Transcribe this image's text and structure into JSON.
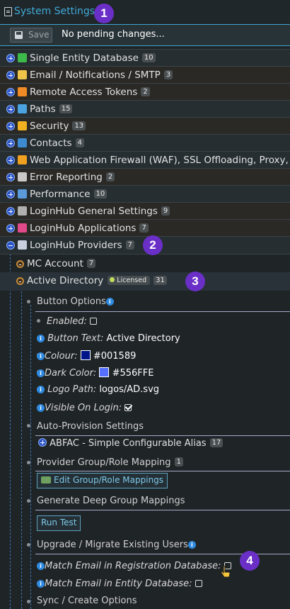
{
  "header": {
    "title": "System Settings"
  },
  "markers": [
    "1",
    "2",
    "3",
    "4"
  ],
  "toolbar": {
    "save_label": "Save",
    "status": "No pending changes..."
  },
  "tree": [
    {
      "label": "Single Entity Database",
      "count": "10",
      "icon": "database-icon",
      "color": "#3db84a"
    },
    {
      "label": "Email / Notifications / SMTP",
      "count": "3",
      "icon": "envelope-icon",
      "color": "#f0c44a"
    },
    {
      "label": "Remote Access Tokens",
      "count": "2",
      "icon": "token-icon",
      "color": "#f08a24"
    },
    {
      "label": "Paths",
      "count": "15",
      "icon": "folder-icon",
      "color": "#4aa3e0"
    },
    {
      "label": "Security",
      "count": "13",
      "icon": "shield-icon",
      "color": "#f0b020"
    },
    {
      "label": "Contacts",
      "count": "4",
      "icon": "contacts-icon",
      "color": "#3d8ad0"
    },
    {
      "label": "Web Application Firewall (WAF), SSL Offloading, Proxy, Lo",
      "count": "",
      "icon": "firewall-icon",
      "color": "#f0a020"
    },
    {
      "label": "Error Reporting",
      "count": "2",
      "icon": "error-report-icon",
      "color": "#c8c8c8"
    },
    {
      "label": "Performance",
      "count": "10",
      "icon": "performance-icon",
      "color": "#5a9ad8"
    },
    {
      "label": "LoginHub General Settings",
      "count": "9",
      "icon": "gears-icon",
      "color": "#b0b0b0"
    },
    {
      "label": "LoginHub Applications",
      "count": "7",
      "icon": "apps-grid-icon",
      "color": "#e04a8a"
    },
    {
      "label": "LoginHub Providers",
      "count": "7",
      "icon": "providers-icon",
      "color": "#c8d0e0"
    }
  ],
  "providers": {
    "mc_account": {
      "label": "MC Account",
      "count": "7"
    },
    "active_directory": {
      "label": "Active Directory",
      "licensed": "Licensed",
      "count": "31"
    }
  },
  "ad": {
    "button_options": "Button Options",
    "enabled_label": "Enabled:",
    "button_text_label": "Button Text:",
    "button_text_value": "Active Directory",
    "colour_label": "Colour:",
    "colour_value": "#001589",
    "dark_color_label": "Dark Color:",
    "dark_color_value": "#556FFE",
    "logo_path_label": "Logo Path:",
    "logo_path_value": "logos/AD.svg",
    "visible_label": "Visible On Login:",
    "auto_provision": "Auto-Provision Settings",
    "abfac": "ABFAC - Simple Configurable Alias",
    "abfac_count": "17",
    "provider_group": "Provider Group/Role Mapping",
    "provider_group_count": "1",
    "edit_mappings": "Edit Group/Role Mappings",
    "deep_group": "Generate Deep Group Mappings",
    "run_test": "Run Test",
    "upgrade": "Upgrade / Migrate Existing Users",
    "match_reg_label": "Match Email in Registration Database:",
    "match_entity_label": "Match Email in Entity Database:",
    "sync": "Sync / Create Options"
  },
  "colors": {
    "accent": "#3fa9d6",
    "colour_swatch": "#001589",
    "dark_swatch": "#556FFE",
    "marker": "#6a2fc7"
  }
}
